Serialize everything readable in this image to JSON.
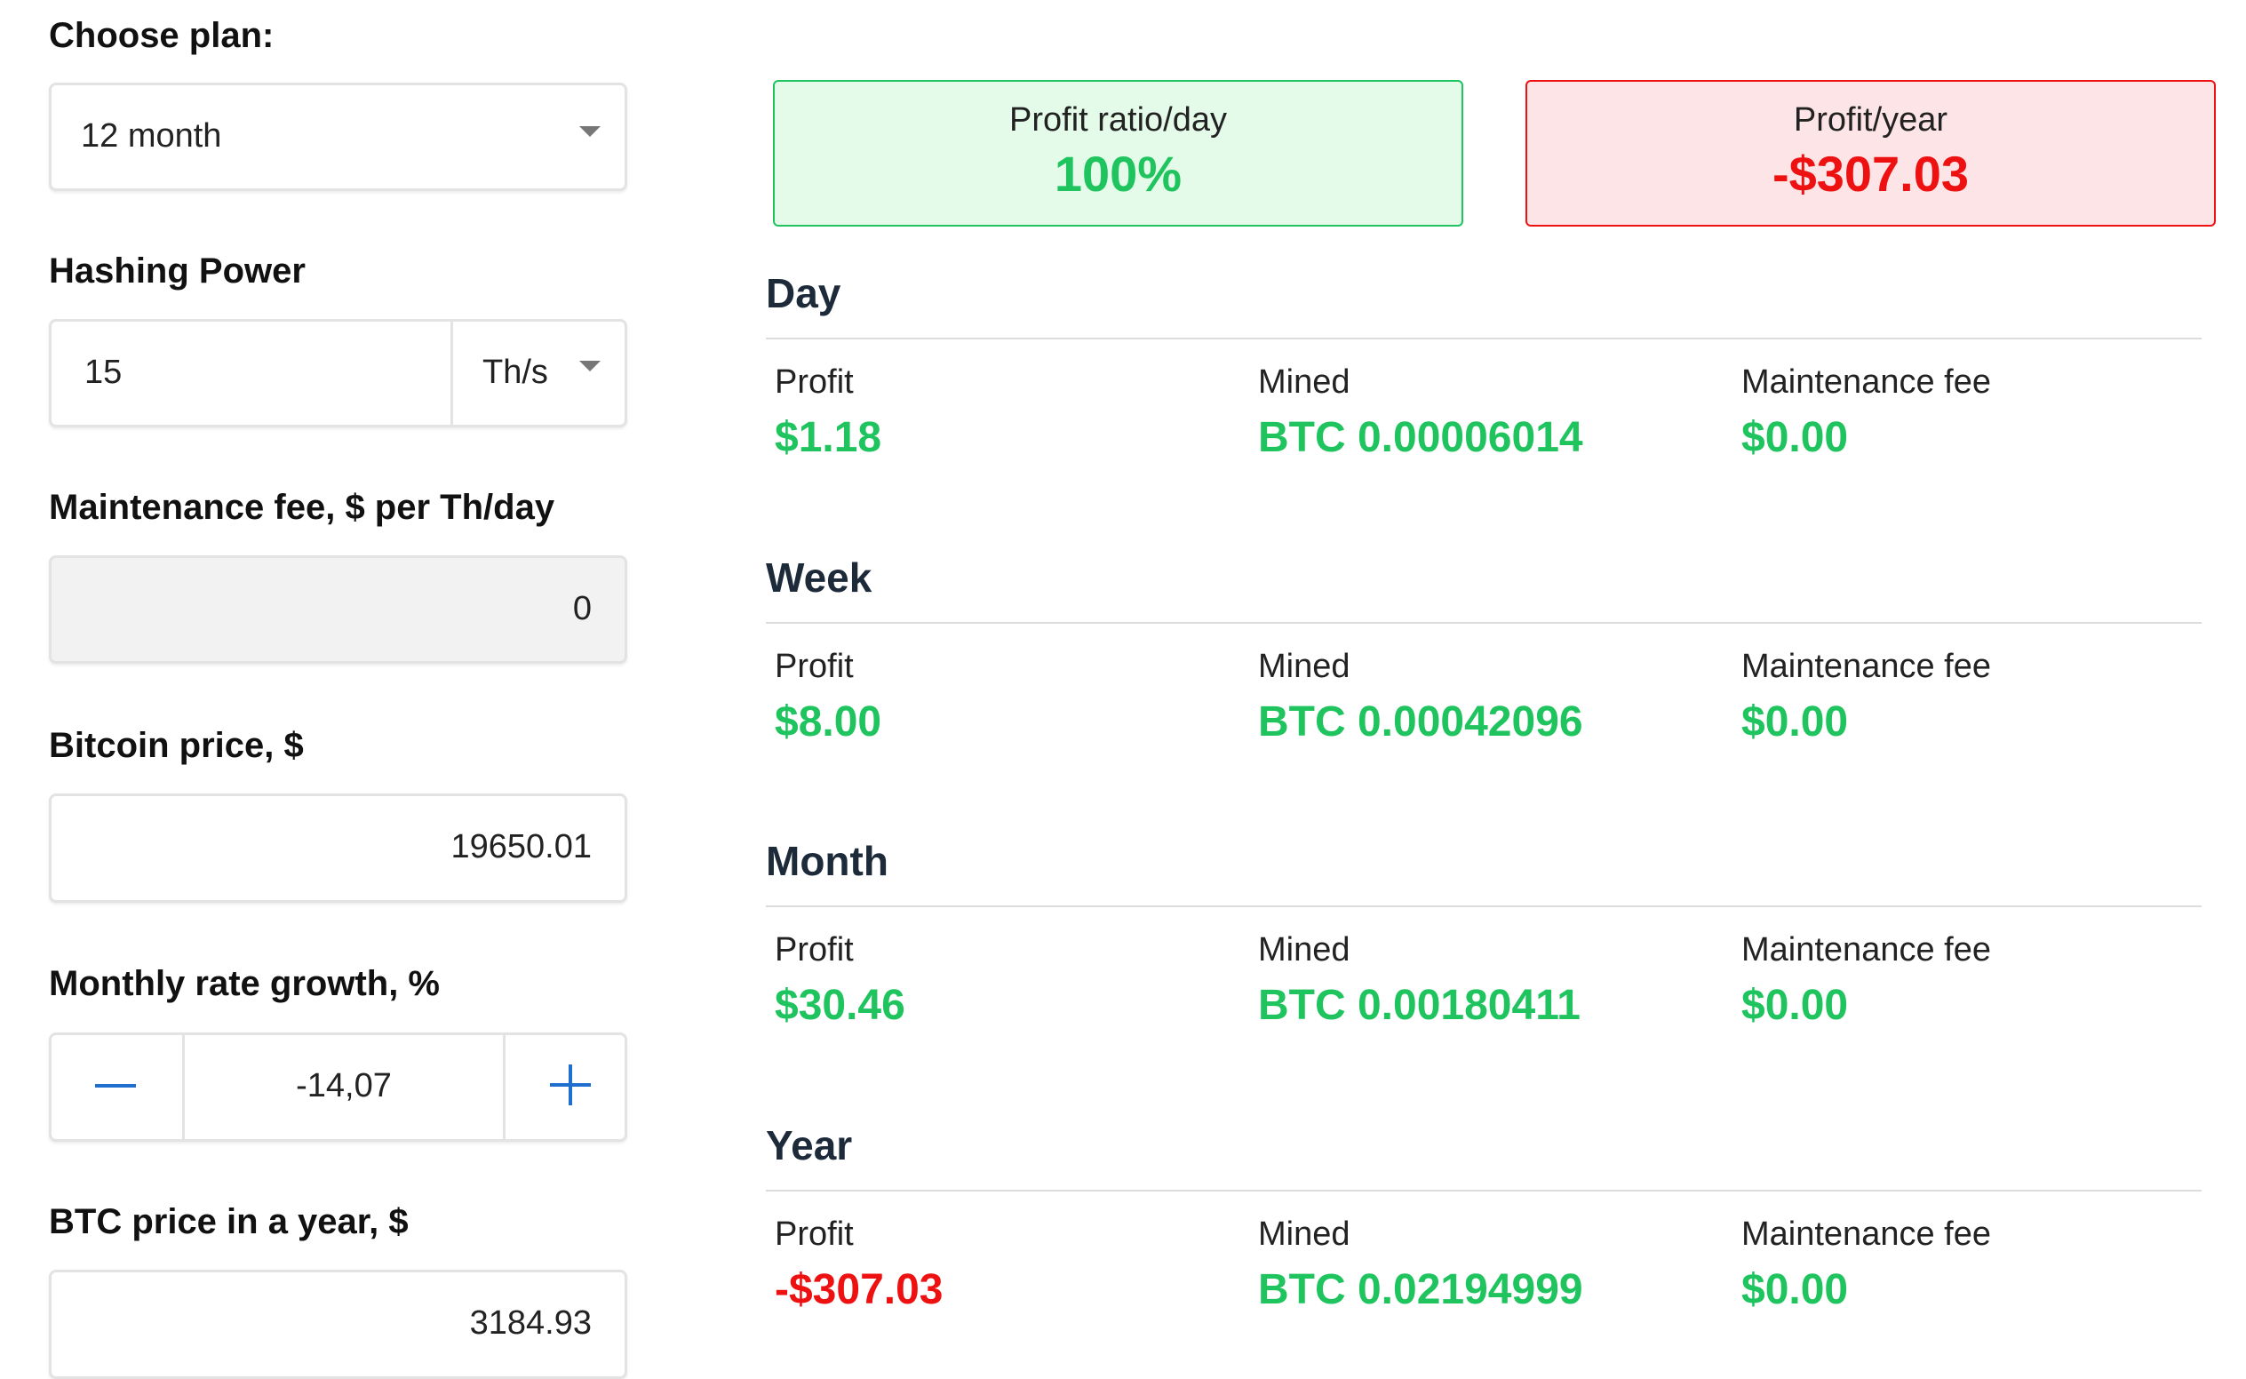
{
  "form": {
    "plan_label": "Choose plan:",
    "plan_value": "12 month",
    "hashing_label": "Hashing Power",
    "hashing_value": "15",
    "hashing_unit": "Th/s",
    "maintenance_label": "Maintenance fee, $ per Th/day",
    "maintenance_value": "0",
    "btc_price_label": "Bitcoin price, $",
    "btc_price_value": "19650.01",
    "growth_label": "Monthly rate growth, %",
    "growth_value": "-14,07",
    "btc_year_label": "BTC price in a year, $",
    "btc_year_value": "3184.93"
  },
  "summary": {
    "ratio_title": "Profit ratio/day",
    "ratio_value": "100%",
    "year_title": "Profit/year",
    "year_value": "-$307.03"
  },
  "periods": [
    {
      "title": "Day",
      "profit_label": "Profit",
      "profit": "$1.18",
      "mined_label": "Mined",
      "mined": "BTC 0.00006014",
      "fee_label": "Maintenance fee",
      "fee": "$0.00"
    },
    {
      "title": "Week",
      "profit_label": "Profit",
      "profit": "$8.00",
      "mined_label": "Mined",
      "mined": "BTC 0.00042096",
      "fee_label": "Maintenance fee",
      "fee": "$0.00"
    },
    {
      "title": "Month",
      "profit_label": "Profit",
      "profit": "$30.46",
      "mined_label": "Mined",
      "mined": "BTC 0.00180411",
      "fee_label": "Maintenance fee",
      "fee": "$0.00"
    },
    {
      "title": "Year",
      "profit_label": "Profit",
      "profit": "-$307.03",
      "mined_label": "Mined",
      "mined": "BTC 0.02194999",
      "fee_label": "Maintenance fee",
      "fee": "$0.00"
    }
  ],
  "colors": {
    "positive": "#1fc45f",
    "negative": "#ee1111",
    "positive_bg": "#e4fbe9",
    "negative_bg": "#fde4e6",
    "accent": "#1f6fd1"
  }
}
